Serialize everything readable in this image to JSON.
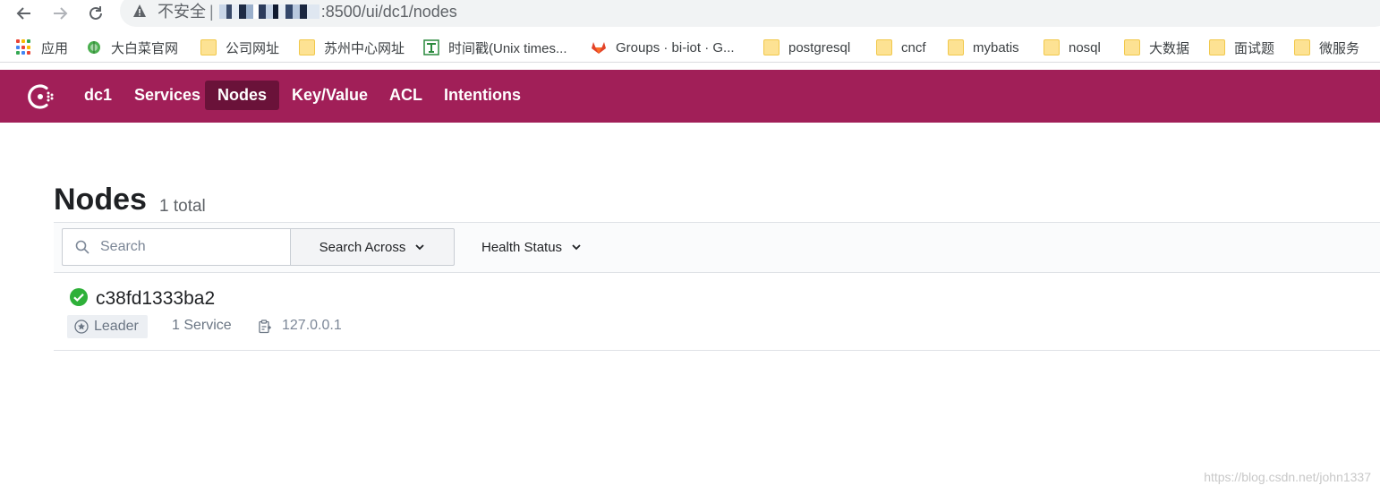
{
  "browser": {
    "security_label": "不安全",
    "separator": "|",
    "address_path": ":8500/ui/dc1/nodes",
    "bookmarks": [
      {
        "label": "应用",
        "icon": "apps-grid-icon"
      },
      {
        "label": "大白菜官网",
        "icon": "cabbage-icon"
      },
      {
        "label": "公司网址",
        "icon": "folder-icon"
      },
      {
        "label": "苏州中心网址",
        "icon": "folder-icon"
      },
      {
        "label": "时间戳(Unix times...",
        "icon": "timestamp-site-icon"
      },
      {
        "label": "Groups · bi-iot · G...",
        "icon": "gitlab-icon"
      },
      {
        "label": "postgresql",
        "icon": "folder-icon"
      },
      {
        "label": "cncf",
        "icon": "folder-icon"
      },
      {
        "label": "mybatis",
        "icon": "folder-icon"
      },
      {
        "label": "nosql",
        "icon": "folder-icon"
      },
      {
        "label": "大数据",
        "icon": "folder-icon"
      },
      {
        "label": "面试题",
        "icon": "folder-icon"
      },
      {
        "label": "微服务",
        "icon": "folder-icon"
      }
    ]
  },
  "header": {
    "datacenter": "dc1",
    "nav": [
      {
        "label": "Services",
        "active": false
      },
      {
        "label": "Nodes",
        "active": true
      },
      {
        "label": "Key/Value",
        "active": false
      },
      {
        "label": "ACL",
        "active": false
      },
      {
        "label": "Intentions",
        "active": false
      }
    ]
  },
  "main": {
    "title": "Nodes",
    "count": "1 total",
    "filters": {
      "search_placeholder": "Search",
      "search_across": "Search Across",
      "health_status": "Health Status"
    },
    "nodes": [
      {
        "name": "c38fd1333ba2",
        "health": "passing",
        "badge": "Leader",
        "services": "1 Service",
        "address": "127.0.0.1"
      }
    ]
  },
  "watermark": "https://blog.csdn.net/john1337",
  "colors": {
    "brand": "#a11f58",
    "brand_active": "#6a1239",
    "health_passing": "#2eb039"
  }
}
